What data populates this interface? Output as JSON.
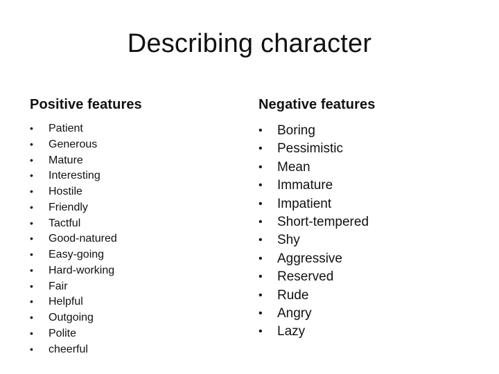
{
  "title": "Describing character",
  "positive": {
    "heading": "Positive features",
    "bullet_icon": "•",
    "items": [
      "Patient",
      "Generous",
      "Mature",
      "Interesting",
      "Hostile",
      "Friendly",
      "Tactful",
      "Good-natured",
      "Easy-going",
      "Hard-working",
      "Fair",
      "Helpful",
      "Outgoing",
      "Polite",
      "cheerful"
    ]
  },
  "negative": {
    "heading": "Negative features",
    "bullet_icon": "•",
    "items": [
      "Boring",
      "Pessimistic",
      "Mean",
      "Immature",
      "Impatient",
      "Short-tempered",
      "Shy",
      "Aggressive",
      "Reserved",
      "Rude",
      "Angry",
      "Lazy"
    ]
  }
}
